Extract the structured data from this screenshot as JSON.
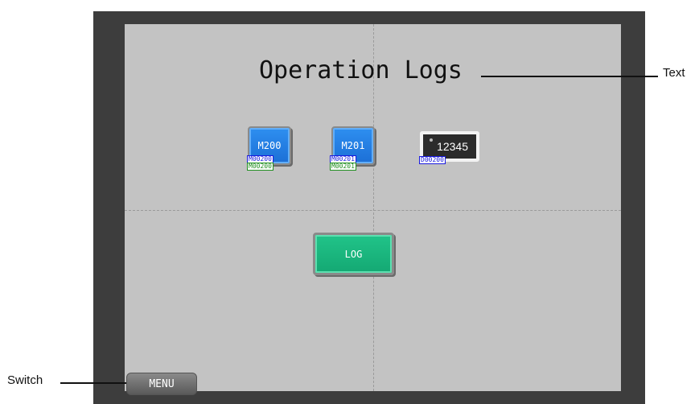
{
  "screen": {
    "title": "Operation Logs"
  },
  "callouts": {
    "text_label": "Text",
    "switch_label": "Switch"
  },
  "buttons": {
    "m200": {
      "label": "M200",
      "addr_top": "M00200",
      "addr_bottom": "M00200"
    },
    "m201": {
      "label": "M201",
      "addr_top": "M00201",
      "addr_bottom": "M00201"
    },
    "log": {
      "label": "LOG"
    },
    "menu": {
      "label": "MENU"
    }
  },
  "numeric_display": {
    "value": "12345",
    "addr": "D00200"
  },
  "colors": {
    "bezel": "#3d3d3d",
    "screen": "#c3c3c3",
    "bit_button": "#1c6fd6",
    "log_button": "#14a873",
    "address_tag_blue": "#1a1adf",
    "address_tag_green": "#1f8f1f"
  }
}
